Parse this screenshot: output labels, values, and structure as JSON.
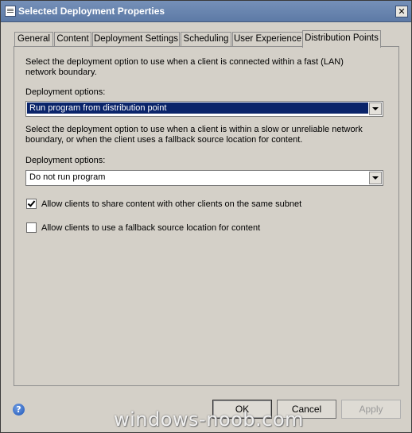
{
  "window": {
    "title": "Selected Deployment Properties",
    "close_glyph": "✕"
  },
  "tabs": [
    {
      "label": "General"
    },
    {
      "label": "Content"
    },
    {
      "label": "Deployment Settings"
    },
    {
      "label": "Scheduling"
    },
    {
      "label": "User Experience"
    },
    {
      "label": "Distribution Points",
      "active": true
    }
  ],
  "panel": {
    "fast_description": "Select the deployment option to use when a client is connected within a fast (LAN) network boundary.",
    "fast_label": "Deployment options:",
    "fast_selected": "Run program from distribution point",
    "slow_description": "Select the deployment option to use when a client is within a slow or unreliable network boundary, or when the client uses a fallback source location for content.",
    "slow_label": "Deployment options:",
    "slow_selected": "Do not run program",
    "share_content_label": "Allow clients to share content with other clients on the same subnet",
    "share_content_checked": true,
    "fallback_label": "Allow clients to use a fallback source location for content",
    "fallback_checked": false
  },
  "footer": {
    "help_glyph": "?",
    "ok_label": "OK",
    "cancel_label": "Cancel",
    "apply_label": "Apply",
    "apply_enabled": false,
    "watermark": "windows-noob.com"
  },
  "colors": {
    "titlebar": "#6a86b0",
    "dialog_bg": "#d4d0c8",
    "selection": "#0a246a"
  }
}
